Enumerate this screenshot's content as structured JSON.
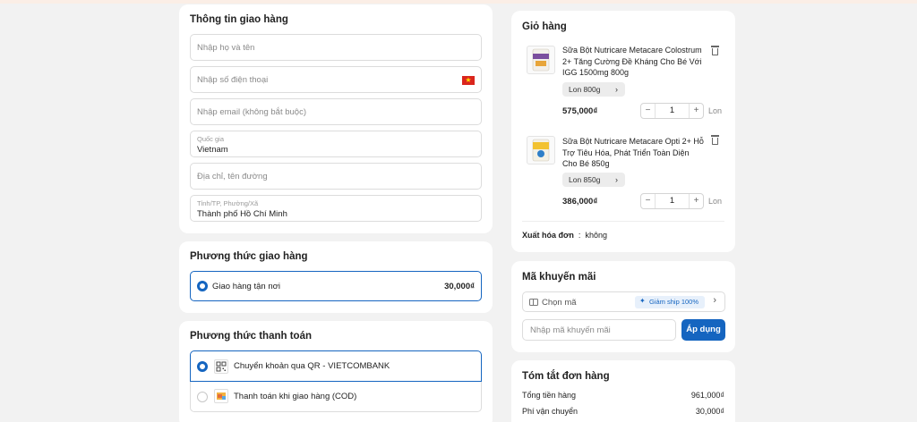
{
  "shipping_info": {
    "title": "Thông tin giao hàng",
    "name_placeholder": "Nhập họ và tên",
    "phone_placeholder": "Nhập số điện thoại",
    "email_placeholder": "Nhập email (không bắt buộc)",
    "country_label": "Quốc gia",
    "country_value": "Vietnam",
    "address_placeholder": "Địa chỉ, tên đường",
    "province_label": "Tỉnh/TP, Phường/Xã",
    "province_value": "Thành phố Hồ Chí Minh"
  },
  "shipping_method": {
    "title": "Phương thức giao hàng",
    "option_label": "Giao hàng tận nơi",
    "option_price": "30,000₫"
  },
  "payment_method": {
    "title": "Phương thức thanh toán",
    "options": [
      {
        "label": "Chuyển khoản qua QR - VIETCOMBANK",
        "icon": "qr-code-icon",
        "selected": true
      },
      {
        "label": "Thanh toán khi giao hàng (COD)",
        "icon": "cash-icon",
        "selected": false
      }
    ]
  },
  "cart": {
    "title": "Giỏ hàng",
    "items": [
      {
        "name": "Sữa Bột Nutricare Metacare Colostrum 2+ Tăng Cường Đề Kháng Cho Bé Với IGG 1500mg 800g",
        "variant": "Lon 800g",
        "price": "575,000₫",
        "qty": "1",
        "unit": "Lon"
      },
      {
        "name": "Sữa Bột Nutricare Metacare Opti 2+ Hỗ Trợ Tiêu Hóa, Phát Triển Toàn Diện Cho Bé 850g",
        "variant": "Lon 850g",
        "price": "386,000₫",
        "qty": "1",
        "unit": "Lon"
      }
    ],
    "invoice_label": "Xuất hóa đơn",
    "invoice_value": "không"
  },
  "promo": {
    "title": "Mã khuyến mãi",
    "select_label": "Chọn mã",
    "badge": "Giảm ship 100%",
    "input_placeholder": "Nhập mã khuyến mãi",
    "apply_label": "Áp dụng"
  },
  "summary": {
    "title": "Tóm tắt đơn hàng",
    "rows": [
      {
        "label": "Tổng tiền hàng",
        "value": "961,000₫"
      },
      {
        "label": "Phí vận chuyển",
        "value": "30,000₫"
      }
    ]
  },
  "colors": {
    "accent": "#1565c0",
    "background": "#f2f2f2",
    "card": "#ffffff",
    "vn_flag": "#da251d"
  }
}
